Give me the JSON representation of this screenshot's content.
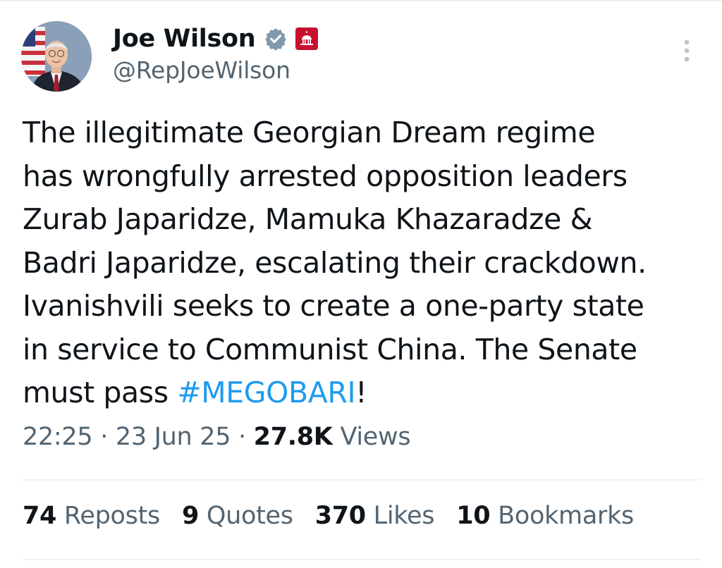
{
  "author": {
    "display_name": "Joe Wilson",
    "handle": "@RepJoeWilson",
    "verified_icon": "verified-badge-icon",
    "affiliation_icon": "capitol-badge-icon",
    "avatar": "profile-photo"
  },
  "menu_icon": "more-vertical-icon",
  "tweet": {
    "lines": [
      "The illegitimate Georgian Dream regime",
      "has wrongfully arrested opposition leaders",
      "Zurab Japaridze, Mamuka Khazaradze &",
      "Badri Japaridze, escalating their crackdown.",
      "Ivanishvili seeks to create a one-party state",
      "in service to Communist China. The Senate"
    ],
    "last_line_prefix": "must pass ",
    "hashtag": "#MEGOBARI",
    "last_line_suffix": "!"
  },
  "meta": {
    "time": "22:25",
    "dot": " · ",
    "date": "23 Jun 25",
    "views_count": "27.8K",
    "views_label": " Views"
  },
  "stats": [
    {
      "count": "74",
      "label": " Reposts"
    },
    {
      "count": "9",
      "label": " Quotes"
    },
    {
      "count": "370",
      "label": " Likes"
    },
    {
      "count": "10",
      "label": " Bookmarks"
    }
  ],
  "colors": {
    "text": "#0f1419",
    "secondary": "#536471",
    "link": "#1d9bf0",
    "divider": "#eff3f4",
    "badge_red": "#c8102e",
    "verified_grey": "#829aab"
  }
}
